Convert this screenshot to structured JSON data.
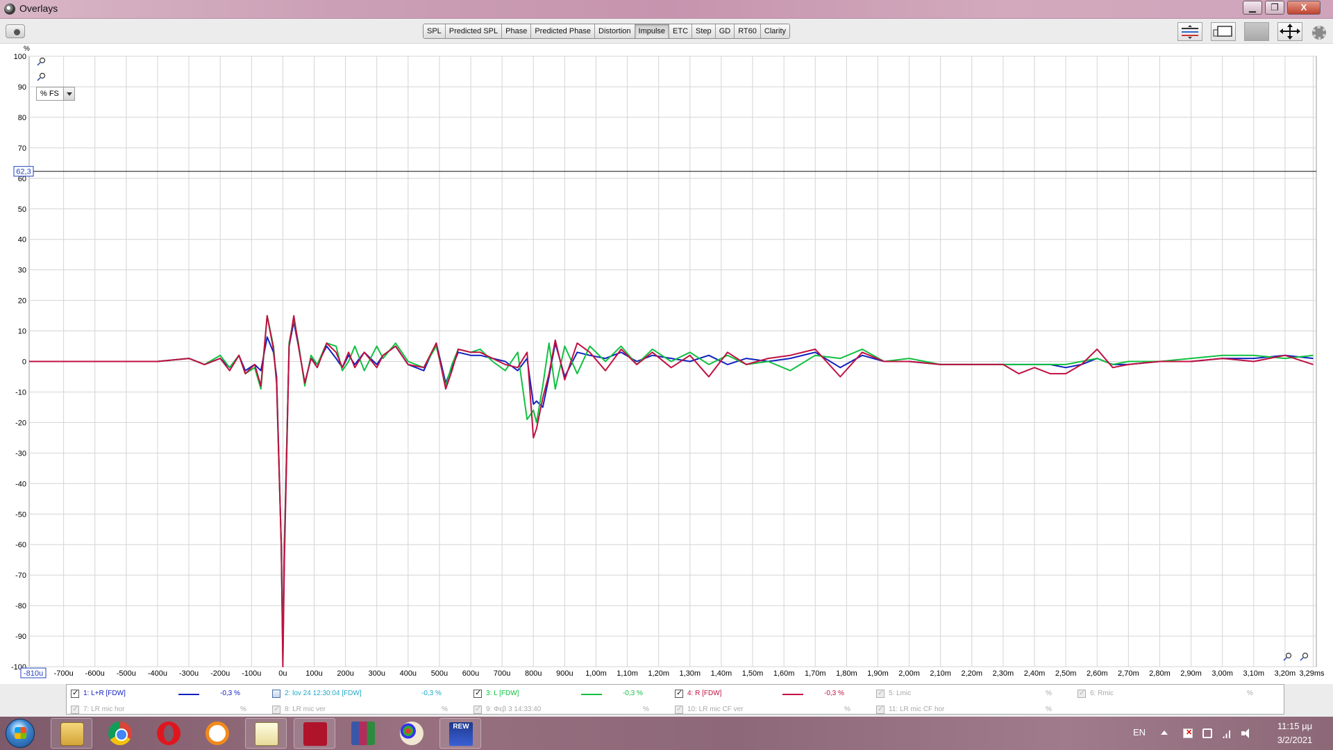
{
  "window": {
    "title": "Overlays",
    "minimize": "▁",
    "maximize": "❐",
    "close": "X"
  },
  "toolbar": {
    "tabs": [
      {
        "label": "SPL",
        "active": false
      },
      {
        "label": "Predicted SPL",
        "active": false
      },
      {
        "label": "Phase",
        "active": false
      },
      {
        "label": "Predicted Phase",
        "active": false
      },
      {
        "label": "Distortion",
        "active": false
      },
      {
        "label": "Impulse",
        "active": true
      },
      {
        "label": "ETC",
        "active": false
      },
      {
        "label": "Step",
        "active": false
      },
      {
        "label": "GD",
        "active": false
      },
      {
        "label": "RT60",
        "active": false
      },
      {
        "label": "Clarity",
        "active": false
      }
    ],
    "icons": [
      "camera-icon",
      "stack-icon",
      "window-icon",
      "blank-tool-icon",
      "move-arrows-icon",
      "gear-icon"
    ]
  },
  "graph": {
    "unit": "%",
    "scale_select": "% FS",
    "cursor_value": "62,3",
    "x_start_label": "-810u"
  },
  "chart_data": {
    "type": "line",
    "title": "",
    "xlabel": "",
    "ylabel": "%",
    "x_unit": "ms",
    "xlim": [
      -0.81,
      3.3
    ],
    "ylim": [
      -100,
      100
    ],
    "grid": true,
    "legend": "bottom",
    "y_ticks": [
      100,
      90,
      80,
      70,
      60,
      50,
      40,
      30,
      20,
      10,
      0,
      -10,
      -20,
      -30,
      -40,
      -50,
      -60,
      -70,
      -80,
      -90,
      -100
    ],
    "y_tick_labels": [
      "100",
      "90",
      "80",
      "70",
      "60",
      "50",
      "40",
      "30",
      "20",
      "10",
      "0",
      "-10",
      "-20",
      "-30",
      "-40",
      "-50",
      "-60",
      "-70",
      "-80",
      "-90",
      "-100"
    ],
    "x_ticks": [
      -0.7,
      -0.6,
      -0.5,
      -0.4,
      -0.3,
      -0.2,
      -0.1,
      0,
      0.1,
      0.2,
      0.3,
      0.4,
      0.5,
      0.6,
      0.7,
      0.8,
      0.9,
      1.0,
      1.1,
      1.2,
      1.3,
      1.4,
      1.5,
      1.6,
      1.7,
      1.8,
      1.9,
      2.0,
      2.1,
      2.2,
      2.3,
      2.4,
      2.5,
      2.6,
      2.7,
      2.8,
      2.9,
      3.0,
      3.1,
      3.2,
      3.29
    ],
    "x_tick_labels": [
      "-700u",
      "-600u",
      "-500u",
      "-400u",
      "-300u",
      "-200u",
      "-100u",
      "0u",
      "100u",
      "200u",
      "300u",
      "400u",
      "500u",
      "600u",
      "700u",
      "800u",
      "900u",
      "1,00m",
      "1,10m",
      "1,20m",
      "1,30m",
      "1,40m",
      "1,50m",
      "1,60m",
      "1,70m",
      "1,80m",
      "1,90m",
      "2,00m",
      "2,10m",
      "2,20m",
      "2,30m",
      "2,40m",
      "2,50m",
      "2,60m",
      "2,70m",
      "2,80m",
      "2,90m",
      "3,00m",
      "3,10m",
      "3,20m",
      "3,29ms"
    ],
    "cursor_y": 62.3,
    "series": [
      {
        "name": "1: L+R [FDW]",
        "color": "#1020c0",
        "x": [
          -0.81,
          -0.6,
          -0.4,
          -0.3,
          -0.25,
          -0.2,
          -0.17,
          -0.14,
          -0.12,
          -0.09,
          -0.07,
          -0.05,
          -0.03,
          -0.02,
          -0.005,
          0.0,
          0.005,
          0.02,
          0.035,
          0.05,
          0.07,
          0.09,
          0.11,
          0.14,
          0.17,
          0.19,
          0.21,
          0.23,
          0.26,
          0.3,
          0.32,
          0.36,
          0.4,
          0.45,
          0.49,
          0.52,
          0.54,
          0.56,
          0.6,
          0.63,
          0.67,
          0.71,
          0.75,
          0.78,
          0.8,
          0.81,
          0.83,
          0.85,
          0.87,
          0.9,
          0.94,
          0.98,
          1.03,
          1.08,
          1.13,
          1.18,
          1.24,
          1.3,
          1.36,
          1.42,
          1.48,
          1.55,
          1.62,
          1.7,
          1.78,
          1.85,
          1.92,
          2.0,
          2.1,
          2.2,
          2.3,
          2.35,
          2.4,
          2.45,
          2.5,
          2.55,
          2.6,
          2.65,
          2.7,
          2.8,
          2.9,
          3.0,
          3.1,
          3.2,
          3.29
        ],
        "y": [
          0,
          0,
          0,
          1,
          -1,
          1,
          -2,
          2,
          -3,
          -1,
          -3,
          8,
          3,
          -5,
          -60,
          -95,
          -60,
          5,
          13,
          5,
          -7,
          1,
          -1,
          5,
          1,
          -2,
          2,
          -1,
          3,
          -1,
          2,
          5,
          -1,
          -3,
          6,
          -7,
          -2,
          3,
          2,
          2,
          1,
          0,
          -3,
          1,
          -14,
          -13,
          -15,
          -5,
          6,
          -5,
          3,
          2,
          1,
          3,
          0,
          2,
          1,
          0,
          2,
          -1,
          1,
          0,
          1,
          3,
          -2,
          2,
          0,
          0,
          -1,
          -1,
          -1,
          -1,
          -1,
          -1,
          -2,
          -1,
          1,
          -1,
          -1,
          0,
          0,
          1,
          1,
          2,
          1
        ]
      },
      {
        "name": "3: L [FDW]",
        "color": "#10c040",
        "x": [
          -0.81,
          -0.6,
          -0.4,
          -0.3,
          -0.25,
          -0.2,
          -0.17,
          -0.14,
          -0.12,
          -0.09,
          -0.07,
          -0.05,
          -0.03,
          -0.02,
          -0.005,
          0.0,
          0.005,
          0.02,
          0.035,
          0.05,
          0.07,
          0.09,
          0.11,
          0.14,
          0.17,
          0.19,
          0.21,
          0.23,
          0.26,
          0.3,
          0.32,
          0.36,
          0.4,
          0.45,
          0.49,
          0.52,
          0.54,
          0.56,
          0.6,
          0.63,
          0.67,
          0.71,
          0.75,
          0.78,
          0.8,
          0.81,
          0.83,
          0.85,
          0.87,
          0.9,
          0.94,
          0.98,
          1.03,
          1.08,
          1.13,
          1.18,
          1.24,
          1.3,
          1.36,
          1.42,
          1.48,
          1.55,
          1.62,
          1.7,
          1.78,
          1.85,
          1.92,
          2.0,
          2.1,
          2.2,
          2.3,
          2.35,
          2.4,
          2.45,
          2.5,
          2.55,
          2.6,
          2.65,
          2.7,
          2.8,
          2.9,
          3.0,
          3.1,
          3.2,
          3.29
        ],
        "y": [
          0,
          0,
          0,
          1,
          -1,
          2,
          -2,
          2,
          -4,
          -2,
          -9,
          15,
          5,
          -7,
          -60,
          -98,
          -62,
          6,
          14,
          6,
          -8,
          2,
          -1,
          6,
          5,
          -3,
          0,
          5,
          -3,
          5,
          1,
          6,
          0,
          -2,
          5,
          -8,
          -1,
          4,
          3,
          4,
          0,
          -3,
          3,
          -19,
          -16,
          -20,
          -8,
          6,
          -9,
          5,
          -4,
          5,
          0,
          5,
          -1,
          4,
          0,
          3,
          -1,
          2,
          -1,
          0,
          -3,
          2,
          1,
          4,
          0,
          1,
          -1,
          -1,
          -1,
          -1,
          -1,
          -1,
          -1,
          0,
          1,
          -1,
          0,
          0,
          1,
          2,
          2,
          1,
          2
        ]
      },
      {
        "name": "4: R [FDW]",
        "color": "#c01040",
        "x": [
          -0.81,
          -0.6,
          -0.4,
          -0.3,
          -0.25,
          -0.2,
          -0.17,
          -0.14,
          -0.12,
          -0.09,
          -0.07,
          -0.05,
          -0.03,
          -0.02,
          -0.005,
          0.0,
          0.005,
          0.02,
          0.035,
          0.05,
          0.07,
          0.09,
          0.11,
          0.14,
          0.17,
          0.19,
          0.21,
          0.23,
          0.26,
          0.3,
          0.32,
          0.36,
          0.4,
          0.45,
          0.49,
          0.52,
          0.54,
          0.56,
          0.6,
          0.63,
          0.67,
          0.71,
          0.75,
          0.78,
          0.8,
          0.81,
          0.83,
          0.85,
          0.87,
          0.9,
          0.94,
          0.98,
          1.03,
          1.08,
          1.13,
          1.18,
          1.24,
          1.3,
          1.36,
          1.42,
          1.48,
          1.55,
          1.62,
          1.7,
          1.78,
          1.85,
          1.92,
          2.0,
          2.1,
          2.2,
          2.3,
          2.35,
          2.4,
          2.45,
          2.5,
          2.55,
          2.6,
          2.65,
          2.7,
          2.8,
          2.9,
          3.0,
          3.1,
          3.2,
          3.29
        ],
        "y": [
          0,
          0,
          0,
          1,
          -1,
          1,
          -3,
          2,
          -4,
          -1,
          -8,
          15,
          4,
          -7,
          -60,
          -100,
          -65,
          5,
          15,
          5,
          -7,
          1,
          -2,
          6,
          3,
          -2,
          3,
          -2,
          3,
          -2,
          2,
          5,
          -1,
          -2,
          6,
          -9,
          -3,
          4,
          3,
          3,
          1,
          -1,
          -2,
          3,
          -25,
          -22,
          -12,
          -4,
          7,
          -6,
          6,
          3,
          -3,
          4,
          -1,
          3,
          -2,
          2,
          -5,
          3,
          -1,
          1,
          2,
          4,
          -5,
          3,
          0,
          0,
          -1,
          -1,
          -1,
          -4,
          -2,
          -4,
          -4,
          -1,
          4,
          -2,
          -1,
          0,
          0,
          1,
          0,
          2,
          -1
        ]
      }
    ]
  },
  "legend": {
    "items": [
      {
        "label": "1: L+R [FDW]",
        "value": "-0,3 %",
        "unit": "",
        "checked": true,
        "enabled": true,
        "color": "#1020c0",
        "line": true
      },
      {
        "label": "2: lov 24 12:30:04 [FDW]",
        "value": "-0,3 %",
        "unit": "",
        "checked": false,
        "enabled": true,
        "color": "#20a8c8",
        "line": false
      },
      {
        "label": "3: L [FDW]",
        "value": "-0,3 %",
        "unit": "",
        "checked": true,
        "enabled": true,
        "color": "#10c040",
        "line": true
      },
      {
        "label": "4: R [FDW]",
        "value": "-0,3 %",
        "unit": "",
        "checked": true,
        "enabled": true,
        "color": "#c01040",
        "line": true
      },
      {
        "label": "5: Lmic",
        "value": "",
        "unit": "%",
        "checked": true,
        "enabled": false,
        "color": "#a8a8a8",
        "line": false
      },
      {
        "label": "6: Rmic",
        "value": "",
        "unit": "%",
        "checked": true,
        "enabled": false,
        "color": "#a8a8a8",
        "line": false
      },
      {
        "label": "7: LR mic hor",
        "value": "",
        "unit": "%",
        "checked": true,
        "enabled": false,
        "color": "#a8a8a8",
        "line": false
      },
      {
        "label": "8: LR mic ver",
        "value": "",
        "unit": "%",
        "checked": true,
        "enabled": false,
        "color": "#a8a8a8",
        "line": false
      },
      {
        "label": "9: Φεβ 3 14:33:40",
        "value": "",
        "unit": "%",
        "checked": true,
        "enabled": false,
        "color": "#a8a8a8",
        "line": false
      },
      {
        "label": "10: LR mic CF ver",
        "value": "",
        "unit": "%",
        "checked": true,
        "enabled": false,
        "color": "#a8a8a8",
        "line": false
      },
      {
        "label": "11: LR mic CF hor",
        "value": "",
        "unit": "%",
        "checked": true,
        "enabled": false,
        "color": "#a8a8a8",
        "line": false
      }
    ]
  },
  "taskbar": {
    "apps": [
      "windows-start-icon",
      "file-explorer-icon",
      "chrome-icon",
      "opera-icon",
      "avast-browser-icon",
      "notepad-icon",
      "rew-dark-icon",
      "winrar-icon",
      "paint-icon",
      "rew-icon"
    ],
    "rew_label": "REW",
    "language": "EN",
    "time": "11:15 μμ",
    "date": "3/2/2021"
  }
}
